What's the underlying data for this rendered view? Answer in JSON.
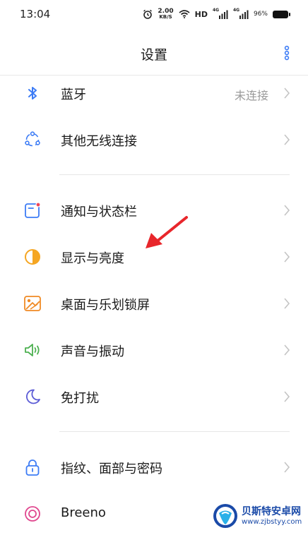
{
  "status_bar": {
    "time": "13:04",
    "net_speed_value": "2.00",
    "net_speed_unit": "KB/S",
    "hd_label": "HD",
    "signal_tag": "4G",
    "battery_percent": "96%"
  },
  "header": {
    "title": "设置"
  },
  "settings": [
    {
      "label": "蓝牙",
      "value": "未连接",
      "icon": "bluetooth-icon",
      "color": "#3d7cf5"
    },
    {
      "label": "其他无线连接",
      "icon": "wireless-connection-icon",
      "color": "#3d7cf5"
    },
    {
      "label": "通知与状态栏",
      "icon": "notification-icon",
      "color": "#3d7cf5"
    },
    {
      "label": "显示与亮度",
      "icon": "brightness-icon",
      "color": "#f5a623"
    },
    {
      "label": "桌面与乐划锁屏",
      "icon": "wallpaper-icon",
      "color": "#f08a24"
    },
    {
      "label": "声音与振动",
      "icon": "speaker-icon",
      "color": "#4cb050"
    },
    {
      "label": "免打扰",
      "icon": "moon-icon",
      "color": "#5b5bd6"
    },
    {
      "label": "指纹、面部与密码",
      "icon": "lock-icon",
      "color": "#3d7cf5"
    },
    {
      "label": "Breeno",
      "icon": "breeno-icon",
      "color": "#e0488f"
    }
  ],
  "colors": {
    "accent": "#3d7cf5",
    "annotation_arrow": "#e8262b"
  },
  "watermark": {
    "name": "贝斯特安卓网",
    "url": "www.zjbstyy.com"
  }
}
